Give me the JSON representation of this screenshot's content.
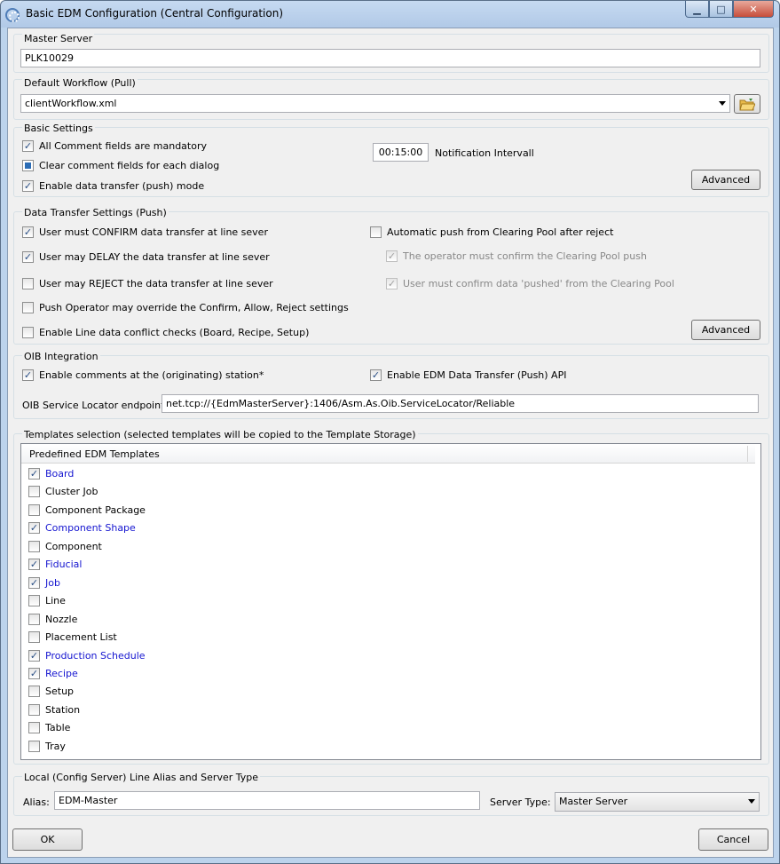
{
  "window": {
    "title": "Basic EDM Configuration (Central Configuration)",
    "minimize": "▁",
    "maximize": "□",
    "close": "✕"
  },
  "master_server": {
    "label": "Master Server",
    "value": "PLK10029"
  },
  "default_workflow": {
    "label": "Default Workflow (Pull)",
    "value": "clientWorkflow.xml"
  },
  "basic_settings": {
    "label": "Basic Settings",
    "all_comment_mandatory": {
      "label": "All Comment fields are mandatory",
      "checked": true
    },
    "clear_comment": {
      "label": "Clear comment fields for each dialog",
      "state": "indeterminate"
    },
    "enable_push": {
      "label": "Enable data transfer (push) mode",
      "checked": true
    },
    "interval_value": "00:15:00",
    "interval_label": "Notification Intervall",
    "advanced": "Advanced"
  },
  "data_transfer": {
    "label": "Data Transfer Settings (Push)",
    "confirm": {
      "label": "User must CONFIRM data transfer at  line sever",
      "checked": true
    },
    "delay": {
      "label": "User may DELAY the data transfer at  line sever",
      "checked": true
    },
    "reject": {
      "label": "User may REJECT the data transfer at  line sever",
      "checked": false
    },
    "override": {
      "label": "Push Operator may override the Confirm, Allow, Reject settings",
      "checked": false
    },
    "conflict": {
      "label": "Enable Line data conflict checks (Board, Recipe, Setup)",
      "checked": false
    },
    "auto_push": {
      "label": "Automatic push from Clearing Pool after reject",
      "checked": false
    },
    "operator_confirm": {
      "label": "The operator must confirm the Clearing Pool push",
      "checked": true
    },
    "user_confirm_pushed": {
      "label": "User must confirm data 'pushed' from the Clearing Pool",
      "checked": true
    },
    "advanced": "Advanced"
  },
  "oib": {
    "label": "OIB Integration",
    "enable_comments": {
      "label": "Enable comments at the (originating) station*",
      "checked": true
    },
    "enable_api": {
      "label": "Enable EDM Data Transfer (Push) API",
      "checked": true
    },
    "endpoint_label": "OIB Service Locator endpoint",
    "endpoint_value": "net.tcp://{EdmMasterServer}:1406/Asm.As.Oib.ServiceLocator/Reliable"
  },
  "templates": {
    "label": "Templates selection (selected templates will be copied to the Template Storage)",
    "column_header": "Predefined EDM Templates",
    "items": [
      {
        "label": "Board",
        "checked": true
      },
      {
        "label": "Cluster Job",
        "checked": false
      },
      {
        "label": "Component Package",
        "checked": false
      },
      {
        "label": "Component Shape",
        "checked": true
      },
      {
        "label": "Component",
        "checked": false
      },
      {
        "label": "Fiducial",
        "checked": true
      },
      {
        "label": "Job",
        "checked": true
      },
      {
        "label": "Line",
        "checked": false
      },
      {
        "label": "Nozzle",
        "checked": false
      },
      {
        "label": "Placement List",
        "checked": false
      },
      {
        "label": "Production Schedule",
        "checked": true
      },
      {
        "label": "Recipe",
        "checked": true
      },
      {
        "label": "Setup",
        "checked": false
      },
      {
        "label": "Station",
        "checked": false
      },
      {
        "label": "Table",
        "checked": false
      },
      {
        "label": "Tray",
        "checked": false
      }
    ]
  },
  "local": {
    "label": "Local (Config Server) Line Alias and Server Type",
    "alias_label": "Alias:",
    "alias_value": "EDM-Master",
    "server_type_label": "Server Type:",
    "server_type_value": "Master Server"
  },
  "footer": {
    "ok": "OK",
    "cancel": "Cancel"
  },
  "colors": {
    "checked_template_text": "#1515d0",
    "title_bar": "#bcd3ec"
  }
}
